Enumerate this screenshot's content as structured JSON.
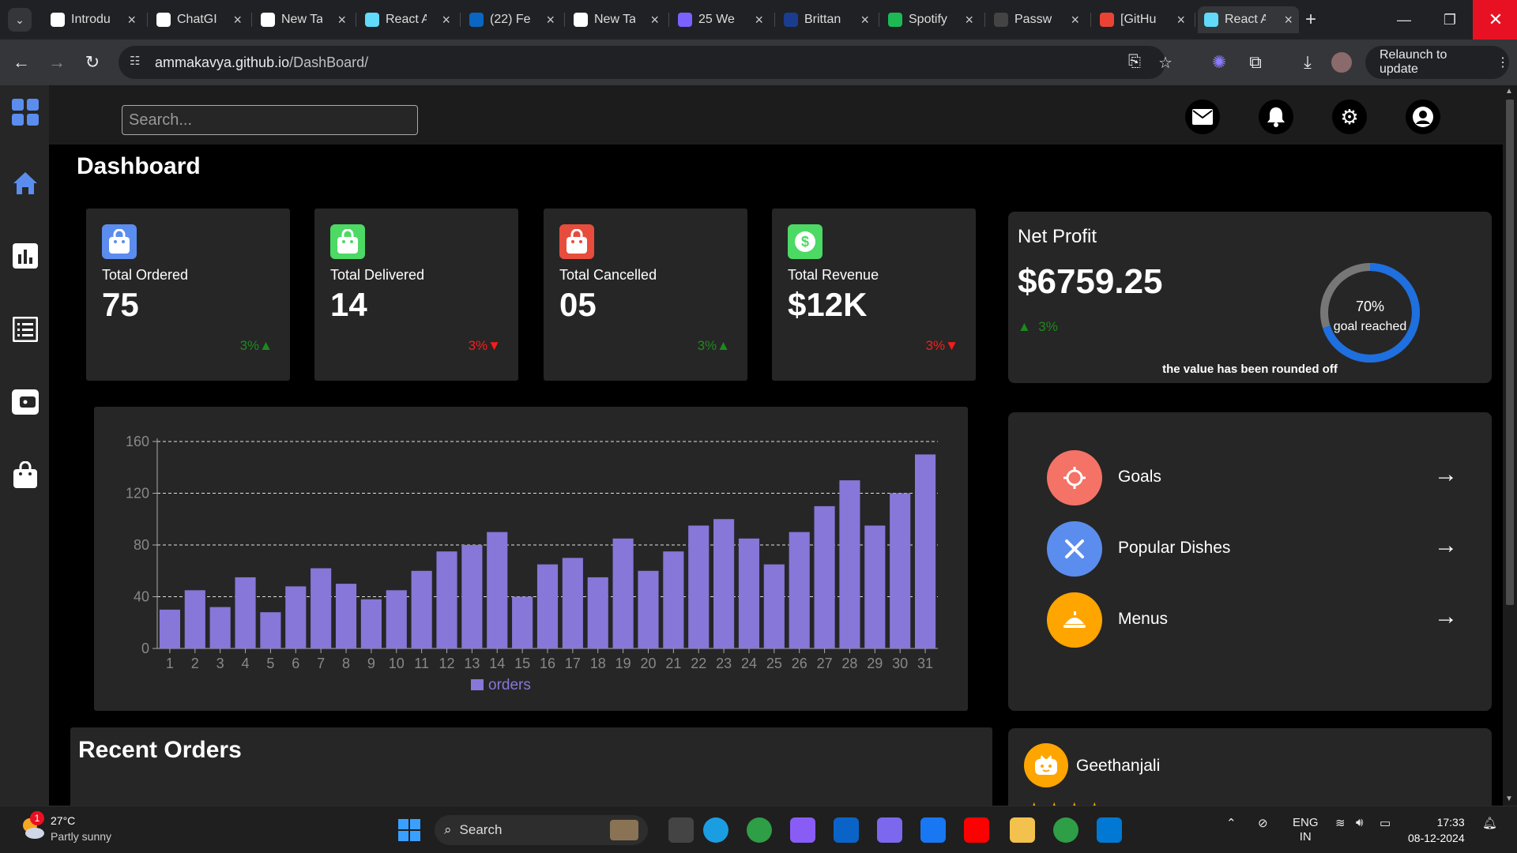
{
  "browser": {
    "tabs": [
      {
        "title": "Introdu",
        "icon": "openai-icon",
        "color": "#ffffff"
      },
      {
        "title": "ChatGI",
        "icon": "openai-icon",
        "color": "#ffffff"
      },
      {
        "title": "New Ta",
        "icon": "chrome-icon",
        "color": "#ffffff"
      },
      {
        "title": "React A",
        "icon": "react-icon",
        "color": "#61dafb"
      },
      {
        "title": "(22) Fe",
        "icon": "linkedin-icon",
        "color": "#0a66c2"
      },
      {
        "title": "New Ta",
        "icon": "chrome-icon",
        "color": "#ffffff"
      },
      {
        "title": "25 We",
        "icon": "m-icon",
        "color": "#7b61ff"
      },
      {
        "title": "Brittan",
        "icon": "b-icon",
        "color": "#1a3d8f"
      },
      {
        "title": "Spotify",
        "icon": "spotify-icon",
        "color": "#1db954"
      },
      {
        "title": "Passw",
        "icon": "github-icon",
        "color": "#444444"
      },
      {
        "title": "[GitHu",
        "icon": "gmail-icon",
        "color": "#ea4335"
      },
      {
        "title": "React A",
        "icon": "react-icon",
        "color": "#61dafb"
      }
    ],
    "url_host": "ammakavya.github.io",
    "url_path": "/DashBoard/",
    "relaunch_label": "Relaunch to update"
  },
  "search": {
    "placeholder": "Search..."
  },
  "page_title": "Dashboard",
  "cards": [
    {
      "label": "Total Ordered",
      "value": "75",
      "change": "3%",
      "trend": "up",
      "icon": "shopping-bag-icon",
      "color": "#5b8def"
    },
    {
      "label": "Total Delivered",
      "value": "14",
      "change": "3%",
      "trend": "down",
      "icon": "shopping-bag-icon",
      "color": "#4cd964"
    },
    {
      "label": "Total Cancelled",
      "value": "05",
      "change": "3%",
      "trend": "up",
      "icon": "shopping-bag-icon",
      "color": "#e74c3c"
    },
    {
      "label": "Total Revenue",
      "value": "$12K",
      "change": "3%",
      "trend": "down",
      "icon": "dollar-icon",
      "color": "#4cd964"
    }
  ],
  "net_profit": {
    "title": "Net Profit",
    "value": "$6759.25",
    "change": "3%",
    "trend": "up",
    "goal_percent": "70%",
    "goal_fraction": 0.7,
    "goal_label": "goal reached",
    "note": "the value has been rounded off"
  },
  "chart_data": {
    "type": "bar",
    "categories": [
      "1",
      "2",
      "3",
      "4",
      "5",
      "6",
      "7",
      "8",
      "9",
      "10",
      "11",
      "12",
      "13",
      "14",
      "15",
      "16",
      "17",
      "18",
      "19",
      "20",
      "21",
      "22",
      "23",
      "24",
      "25",
      "26",
      "27",
      "28",
      "29",
      "30",
      "31"
    ],
    "series": [
      {
        "name": "orders",
        "values": [
          30,
          45,
          32,
          55,
          28,
          48,
          62,
          50,
          38,
          45,
          60,
          75,
          80,
          90,
          40,
          65,
          70,
          55,
          85,
          60,
          75,
          95,
          100,
          85,
          65,
          90,
          110,
          130,
          95,
          120,
          150
        ]
      }
    ],
    "ylim": [
      0,
      160
    ],
    "yticks": [
      0,
      40,
      80,
      120,
      160
    ],
    "grid": true,
    "legend": "bottom",
    "bar_color": "#8677d9"
  },
  "quick_links": [
    {
      "label": "Goals",
      "icon": "target-icon",
      "color": "#f47266"
    },
    {
      "label": "Popular Dishes",
      "icon": "utensils-icon",
      "color": "#5b8def"
    },
    {
      "label": "Menus",
      "icon": "food-icon",
      "color": "#ffa500"
    }
  ],
  "recent_orders": {
    "title": "Recent Orders"
  },
  "review": {
    "name": "Geethanjali",
    "stars": "★★★★"
  },
  "taskbar": {
    "temperature": "27°C",
    "weather": "Partly sunny",
    "weather_badge": "1",
    "search_label": "Search",
    "lang": "ENG",
    "region": "IN",
    "time": "17:33",
    "date": "08-12-2024"
  }
}
